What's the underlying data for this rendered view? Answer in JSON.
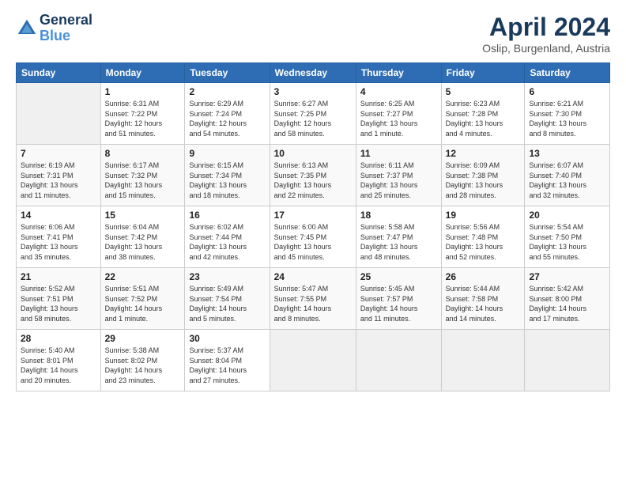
{
  "logo": {
    "line1": "General",
    "line2": "Blue"
  },
  "header": {
    "month": "April 2024",
    "location": "Oslip, Burgenland, Austria"
  },
  "weekdays": [
    "Sunday",
    "Monday",
    "Tuesday",
    "Wednesday",
    "Thursday",
    "Friday",
    "Saturday"
  ],
  "weeks": [
    [
      {
        "day": "",
        "info": ""
      },
      {
        "day": "1",
        "info": "Sunrise: 6:31 AM\nSunset: 7:22 PM\nDaylight: 12 hours\nand 51 minutes."
      },
      {
        "day": "2",
        "info": "Sunrise: 6:29 AM\nSunset: 7:24 PM\nDaylight: 12 hours\nand 54 minutes."
      },
      {
        "day": "3",
        "info": "Sunrise: 6:27 AM\nSunset: 7:25 PM\nDaylight: 12 hours\nand 58 minutes."
      },
      {
        "day": "4",
        "info": "Sunrise: 6:25 AM\nSunset: 7:27 PM\nDaylight: 13 hours\nand 1 minute."
      },
      {
        "day": "5",
        "info": "Sunrise: 6:23 AM\nSunset: 7:28 PM\nDaylight: 13 hours\nand 4 minutes."
      },
      {
        "day": "6",
        "info": "Sunrise: 6:21 AM\nSunset: 7:30 PM\nDaylight: 13 hours\nand 8 minutes."
      }
    ],
    [
      {
        "day": "7",
        "info": "Sunrise: 6:19 AM\nSunset: 7:31 PM\nDaylight: 13 hours\nand 11 minutes."
      },
      {
        "day": "8",
        "info": "Sunrise: 6:17 AM\nSunset: 7:32 PM\nDaylight: 13 hours\nand 15 minutes."
      },
      {
        "day": "9",
        "info": "Sunrise: 6:15 AM\nSunset: 7:34 PM\nDaylight: 13 hours\nand 18 minutes."
      },
      {
        "day": "10",
        "info": "Sunrise: 6:13 AM\nSunset: 7:35 PM\nDaylight: 13 hours\nand 22 minutes."
      },
      {
        "day": "11",
        "info": "Sunrise: 6:11 AM\nSunset: 7:37 PM\nDaylight: 13 hours\nand 25 minutes."
      },
      {
        "day": "12",
        "info": "Sunrise: 6:09 AM\nSunset: 7:38 PM\nDaylight: 13 hours\nand 28 minutes."
      },
      {
        "day": "13",
        "info": "Sunrise: 6:07 AM\nSunset: 7:40 PM\nDaylight: 13 hours\nand 32 minutes."
      }
    ],
    [
      {
        "day": "14",
        "info": "Sunrise: 6:06 AM\nSunset: 7:41 PM\nDaylight: 13 hours\nand 35 minutes."
      },
      {
        "day": "15",
        "info": "Sunrise: 6:04 AM\nSunset: 7:42 PM\nDaylight: 13 hours\nand 38 minutes."
      },
      {
        "day": "16",
        "info": "Sunrise: 6:02 AM\nSunset: 7:44 PM\nDaylight: 13 hours\nand 42 minutes."
      },
      {
        "day": "17",
        "info": "Sunrise: 6:00 AM\nSunset: 7:45 PM\nDaylight: 13 hours\nand 45 minutes."
      },
      {
        "day": "18",
        "info": "Sunrise: 5:58 AM\nSunset: 7:47 PM\nDaylight: 13 hours\nand 48 minutes."
      },
      {
        "day": "19",
        "info": "Sunrise: 5:56 AM\nSunset: 7:48 PM\nDaylight: 13 hours\nand 52 minutes."
      },
      {
        "day": "20",
        "info": "Sunrise: 5:54 AM\nSunset: 7:50 PM\nDaylight: 13 hours\nand 55 minutes."
      }
    ],
    [
      {
        "day": "21",
        "info": "Sunrise: 5:52 AM\nSunset: 7:51 PM\nDaylight: 13 hours\nand 58 minutes."
      },
      {
        "day": "22",
        "info": "Sunrise: 5:51 AM\nSunset: 7:52 PM\nDaylight: 14 hours\nand 1 minute."
      },
      {
        "day": "23",
        "info": "Sunrise: 5:49 AM\nSunset: 7:54 PM\nDaylight: 14 hours\nand 5 minutes."
      },
      {
        "day": "24",
        "info": "Sunrise: 5:47 AM\nSunset: 7:55 PM\nDaylight: 14 hours\nand 8 minutes."
      },
      {
        "day": "25",
        "info": "Sunrise: 5:45 AM\nSunset: 7:57 PM\nDaylight: 14 hours\nand 11 minutes."
      },
      {
        "day": "26",
        "info": "Sunrise: 5:44 AM\nSunset: 7:58 PM\nDaylight: 14 hours\nand 14 minutes."
      },
      {
        "day": "27",
        "info": "Sunrise: 5:42 AM\nSunset: 8:00 PM\nDaylight: 14 hours\nand 17 minutes."
      }
    ],
    [
      {
        "day": "28",
        "info": "Sunrise: 5:40 AM\nSunset: 8:01 PM\nDaylight: 14 hours\nand 20 minutes."
      },
      {
        "day": "29",
        "info": "Sunrise: 5:38 AM\nSunset: 8:02 PM\nDaylight: 14 hours\nand 23 minutes."
      },
      {
        "day": "30",
        "info": "Sunrise: 5:37 AM\nSunset: 8:04 PM\nDaylight: 14 hours\nand 27 minutes."
      },
      {
        "day": "",
        "info": ""
      },
      {
        "day": "",
        "info": ""
      },
      {
        "day": "",
        "info": ""
      },
      {
        "day": "",
        "info": ""
      }
    ]
  ]
}
